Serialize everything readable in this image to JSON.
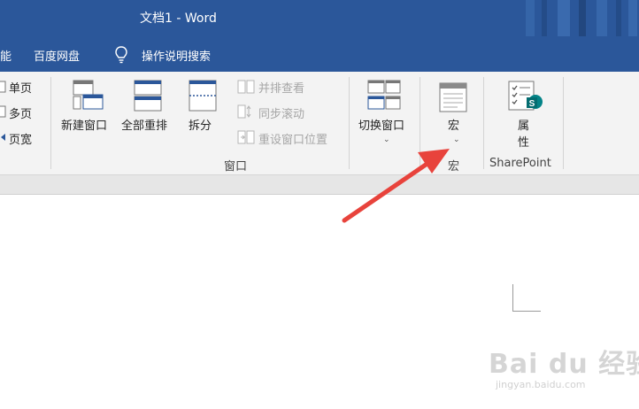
{
  "titlebar": {
    "title": "文档1  -  Word",
    "color": "#2b579a"
  },
  "menubar": {
    "items": [
      {
        "label": "能"
      },
      {
        "label": "百度网盘"
      },
      {
        "label": "操作说明搜索"
      }
    ]
  },
  "ribbon": {
    "view_group": {
      "items": [
        {
          "label": "单页"
        },
        {
          "label": "多页"
        },
        {
          "label": "页宽"
        }
      ]
    },
    "window_group": {
      "label": "窗口",
      "new_window": "新建窗口",
      "arrange_all": "全部重排",
      "split": "拆分",
      "side_by_side": "并排查看",
      "sync_scroll": "同步滚动",
      "reset_position": "重设窗口位置",
      "switch_window": "切换窗口"
    },
    "macros_group": {
      "label": "宏",
      "button": "宏"
    },
    "sharepoint_group": {
      "label": "SharePoint",
      "button_line1": "属",
      "button_line2": "性"
    }
  },
  "watermark": {
    "logo": "Bai du 经验",
    "url": "jingyan.baidu.com"
  },
  "colors": {
    "accent": "#2b579a",
    "arrow": "#e8433c"
  }
}
